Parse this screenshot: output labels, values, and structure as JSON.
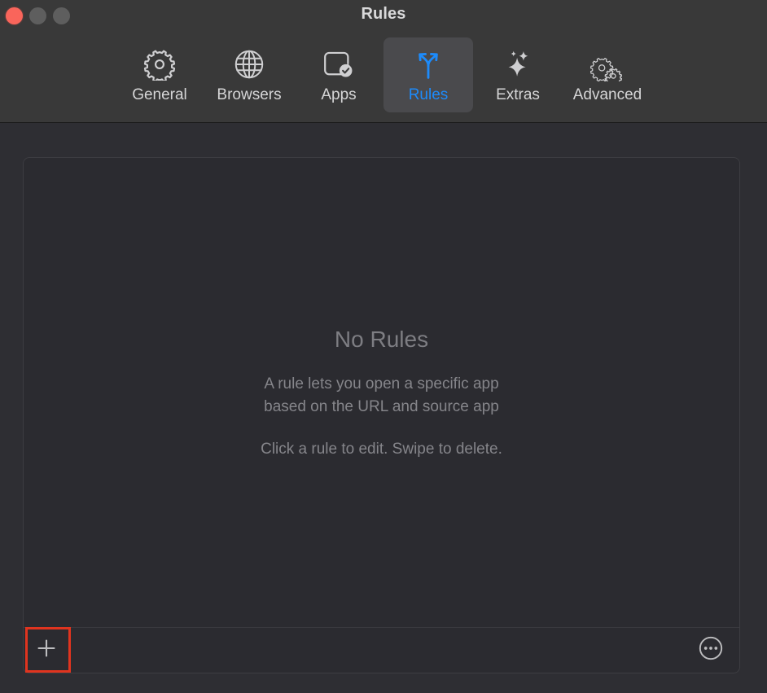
{
  "window": {
    "title": "Rules",
    "traffic_lights": [
      {
        "name": "close",
        "color": "#f9655b"
      },
      {
        "name": "minimize",
        "color": "#5e5e5e"
      },
      {
        "name": "zoom",
        "color": "#5e5e5e"
      }
    ]
  },
  "toolbar": {
    "tabs": [
      {
        "label": "General",
        "icon": "gear-icon",
        "selected": false
      },
      {
        "label": "Browsers",
        "icon": "globe-icon",
        "selected": false
      },
      {
        "label": "Apps",
        "icon": "app-check-icon",
        "selected": false
      },
      {
        "label": "Rules",
        "icon": "branch-icon",
        "selected": true
      },
      {
        "label": "Extras",
        "icon": "sparkles-icon",
        "selected": false
      },
      {
        "label": "Advanced",
        "icon": "gears-icon",
        "selected": false
      }
    ],
    "selected_color": "#1d8bfb",
    "label_color": "#d6d6d7"
  },
  "main": {
    "empty_state": {
      "title": "No Rules",
      "description_line1": "A rule lets you open a specific app",
      "description_line2": "based on the URL and source app",
      "hint": "Click a rule to edit. Swipe to delete."
    },
    "bottom_bar": {
      "add_label": "+",
      "add_icon": "plus-icon",
      "more_icon": "ellipsis-circle-icon"
    },
    "highlight": {
      "target": "add-rule-button",
      "color": "#e0341f"
    }
  }
}
